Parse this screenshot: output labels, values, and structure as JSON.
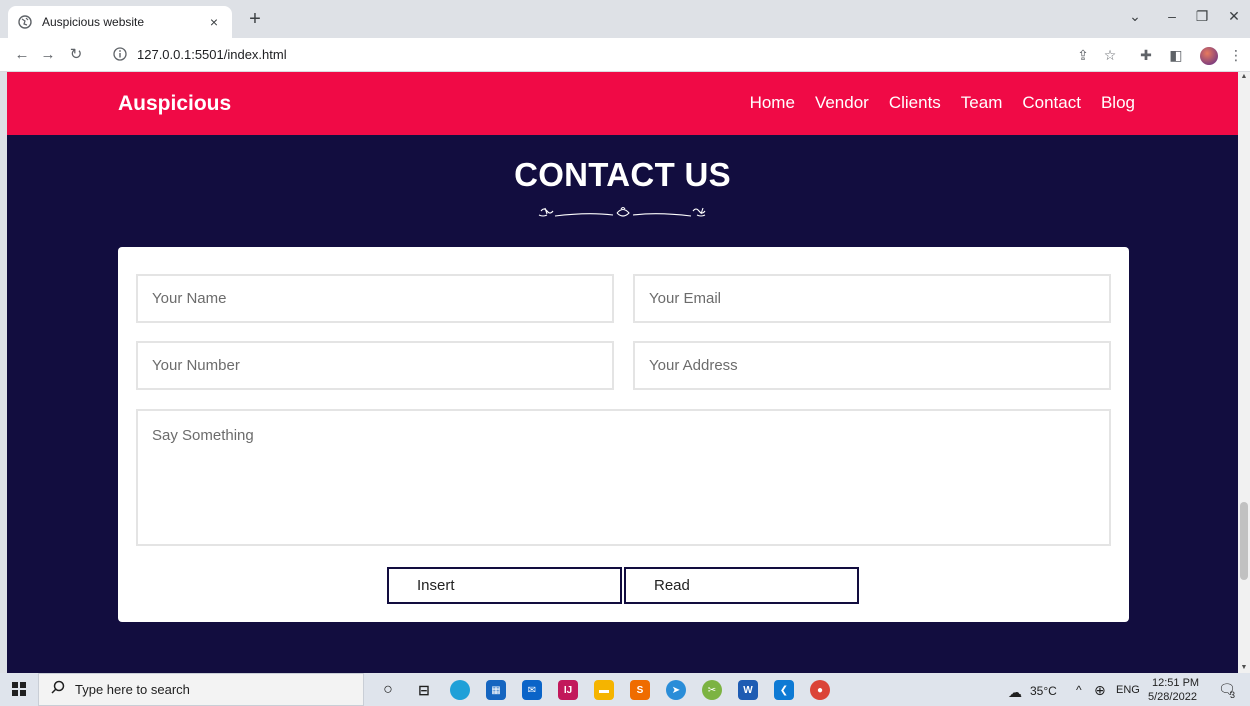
{
  "browser": {
    "tab_title": "Auspicious website",
    "tab_close": "×",
    "new_tab": "+",
    "url": "127.0.0.1:5501/index.html",
    "controls": {
      "chevron": "⌄",
      "minimize": "–",
      "restore": "❐",
      "close": "✕"
    }
  },
  "site": {
    "brand": "Auspicious",
    "nav": [
      "Home",
      "Vendor",
      "Clients",
      "Team",
      "Contact",
      "Blog"
    ],
    "title": "CONTACT US",
    "form": {
      "name_placeholder": "Your Name",
      "email_placeholder": "Your Email",
      "number_placeholder": "Your Number",
      "address_placeholder": "Your Address",
      "message_placeholder": "Say Something",
      "insert_label": "Insert",
      "read_label": "Read"
    },
    "colors": {
      "header": "#f00a46",
      "background": "#120d3f",
      "card": "#ffffff"
    }
  },
  "taskbar": {
    "search_placeholder": "Type here to search",
    "weather": "35°C",
    "language": "ENG",
    "time": "12:51 PM",
    "date": "5/28/2022",
    "notifications": "3"
  }
}
